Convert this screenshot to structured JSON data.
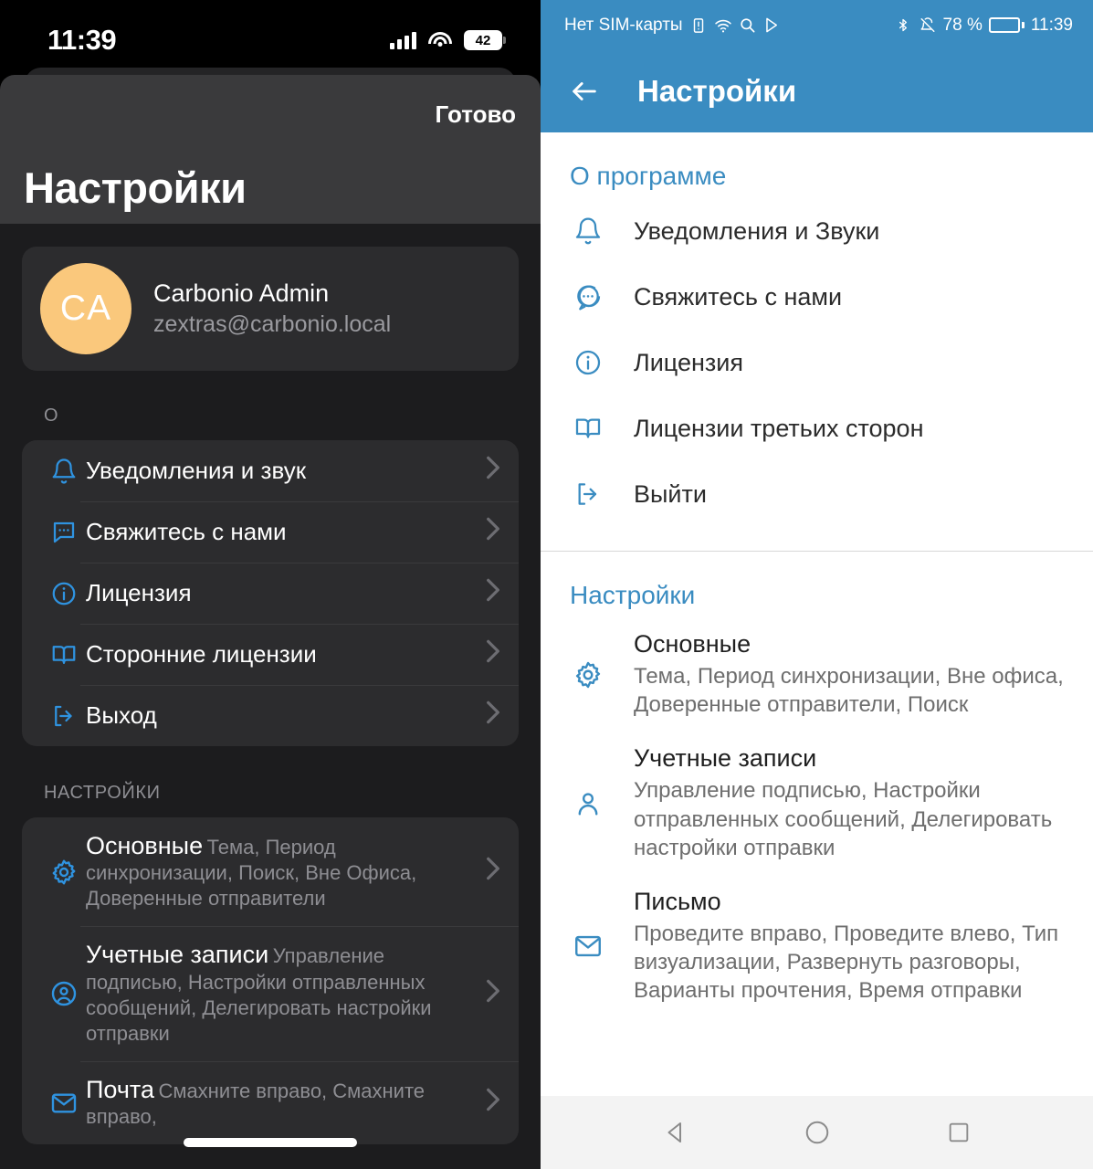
{
  "ios": {
    "status": {
      "time": "11:39",
      "battery_level": "42",
      "signal_icon": "cellular-signal-icon",
      "wifi_icon": "wifi-icon",
      "battery_icon": "battery-icon"
    },
    "done_label": "Готово",
    "title": "Настройки",
    "account": {
      "initials": "CA",
      "name": "Carbonio Admin",
      "email": "zextras@carbonio.local"
    },
    "section_about_label": "О",
    "about_items": [
      {
        "icon": "bell-icon",
        "label": "Уведомления и звук"
      },
      {
        "icon": "chat-bubble-icon",
        "label": "Свяжитесь с нами"
      },
      {
        "icon": "info-circle-icon",
        "label": "Лицензия"
      },
      {
        "icon": "book-icon",
        "label": "Сторонние лицензии"
      },
      {
        "icon": "logout-icon",
        "label": "Выход"
      }
    ],
    "section_settings_label": "НАСТРОЙКИ",
    "settings_items": [
      {
        "icon": "gear-icon",
        "title": "Основные",
        "subtitle": "Тема, Период синхронизации, Поиск, Вне Офиса, Доверенные отправители"
      },
      {
        "icon": "account-circle-icon",
        "title": "Учетные записи",
        "subtitle": "Управление подписью, Настройки отправленных сообщений, Делегировать настройки отправки"
      },
      {
        "icon": "mail-icon",
        "title": "Почта",
        "subtitle": "Смахните вправо, Смахните вправо,"
      }
    ],
    "accent_color": "#2f93e0",
    "avatar_color": "#fac87c",
    "sheet_bg": "#1c1c1e",
    "card_bg": "#2c2c2e"
  },
  "android": {
    "status": {
      "sim_text": "Нет SIM-карты",
      "sim_alert_icon": "sim-alert-icon",
      "wifi_icon": "wifi-icon",
      "search_icon": "search-icon",
      "play_icon": "play-store-icon",
      "bluetooth_icon": "bluetooth-icon",
      "mute_icon": "bell-muted-icon",
      "battery_percent": "78 %",
      "battery_icon": "battery-icon",
      "time": "11:39"
    },
    "back_icon": "arrow-back-icon",
    "title": "Настройки",
    "section_about_label": "О программе",
    "about_items": [
      {
        "icon": "bell-icon",
        "label": "Уведомления и Звуки"
      },
      {
        "icon": "chat-bubble-icon",
        "label": "Свяжитесь с нами"
      },
      {
        "icon": "info-circle-icon",
        "label": "Лицензия"
      },
      {
        "icon": "book-icon",
        "label": "Лицензии третьих сторон"
      },
      {
        "icon": "logout-icon",
        "label": "Выйти"
      }
    ],
    "section_settings_label": "Настройки",
    "settings_items": [
      {
        "icon": "gear-icon",
        "title": "Основные",
        "subtitle": "Тема, Период синхронизации, Вне офиса, Доверенные отправители, Поиск"
      },
      {
        "icon": "person-icon",
        "title": "Учетные записи",
        "subtitle": "Управление подписью, Настройки отправленных сообщений, Делегировать настройки отправки"
      },
      {
        "icon": "mail-icon",
        "title": "Письмо",
        "subtitle": "Проведите вправо, Проведите влево, Тип визуализации, Развернуть разговоры, Варианты прочтения, Время отправки"
      }
    ],
    "navbar": [
      {
        "icon": "nav-back-triangle-icon"
      },
      {
        "icon": "nav-home-circle-icon"
      },
      {
        "icon": "nav-recents-square-icon"
      }
    ],
    "accent_color": "#3a8cc1"
  }
}
